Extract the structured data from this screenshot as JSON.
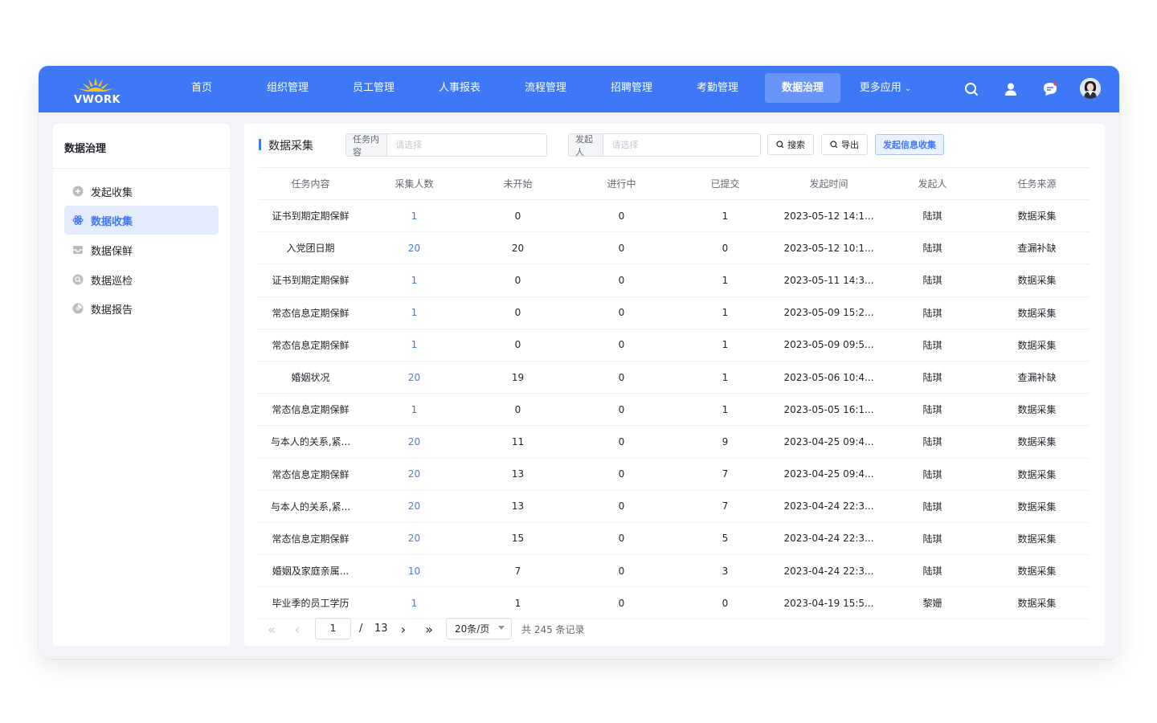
{
  "app": {
    "logo_text": "VWORK"
  },
  "nav": {
    "items": [
      "首页",
      "组织管理",
      "员工管理",
      "人事报表",
      "流程管理",
      "招聘管理",
      "考勤管理",
      "数据治理"
    ],
    "active_index": 7,
    "more_label": "更多应用"
  },
  "colors": {
    "brand": "#3f78f6",
    "active_bg": "#e3ebfd",
    "link": "#3f78f6"
  },
  "sidebar": {
    "title": "数据治理",
    "items": [
      {
        "label": "发起收集",
        "icon": "plus-circle-icon"
      },
      {
        "label": "数据收集",
        "icon": "atom-icon",
        "active": true
      },
      {
        "label": "数据保鲜",
        "icon": "inbox-icon"
      },
      {
        "label": "数据巡检",
        "icon": "inspect-icon"
      },
      {
        "label": "数据报告",
        "icon": "report-icon"
      }
    ]
  },
  "main": {
    "title": "数据采集",
    "filter_task": {
      "label": "任务内容",
      "placeholder": "请选择"
    },
    "filter_initiator": {
      "label": "发起人",
      "placeholder": "请选择"
    },
    "search_label": "搜索",
    "export_label": "导出",
    "launch_label": "发起信息收集"
  },
  "table": {
    "columns": [
      "任务内容",
      "采集人数",
      "未开始",
      "进行中",
      "已提交",
      "发起时间",
      "发起人",
      "任务来源"
    ],
    "rows": [
      [
        "证书到期定期保鲜",
        "1",
        "0",
        "0",
        "1",
        "2023-05-12 14:1...",
        "陆琪",
        "数据采集"
      ],
      [
        "入党团日期",
        "20",
        "20",
        "0",
        "0",
        "2023-05-12 10:1...",
        "陆琪",
        "查漏补缺"
      ],
      [
        "证书到期定期保鲜",
        "1",
        "0",
        "0",
        "1",
        "2023-05-11 14:3...",
        "陆琪",
        "数据采集"
      ],
      [
        "常态信息定期保鲜",
        "1",
        "0",
        "0",
        "1",
        "2023-05-09 15:2...",
        "陆琪",
        "数据采集"
      ],
      [
        "常态信息定期保鲜",
        "1",
        "0",
        "0",
        "1",
        "2023-05-09 09:5...",
        "陆琪",
        "数据采集"
      ],
      [
        "婚姻状况",
        "20",
        "19",
        "0",
        "1",
        "2023-05-06 10:4...",
        "陆琪",
        "查漏补缺"
      ],
      [
        "常态信息定期保鲜",
        "1",
        "0",
        "0",
        "1",
        "2023-05-05 16:1...",
        "陆琪",
        "数据采集"
      ],
      [
        "与本人的关系,紧...",
        "20",
        "11",
        "0",
        "9",
        "2023-04-25 09:4...",
        "陆琪",
        "数据采集"
      ],
      [
        "常态信息定期保鲜",
        "20",
        "13",
        "0",
        "7",
        "2023-04-25 09:4...",
        "陆琪",
        "数据采集"
      ],
      [
        "与本人的关系,紧...",
        "20",
        "13",
        "0",
        "7",
        "2023-04-24 22:3...",
        "陆琪",
        "数据采集"
      ],
      [
        "常态信息定期保鲜",
        "20",
        "15",
        "0",
        "5",
        "2023-04-24 22:3...",
        "陆琪",
        "数据采集"
      ],
      [
        "婚姻及家庭亲属...",
        "10",
        "7",
        "0",
        "3",
        "2023-04-24 22:3...",
        "陆琪",
        "数据采集"
      ],
      [
        "毕业季的员工学历",
        "1",
        "1",
        "0",
        "0",
        "2023-04-19 15:5...",
        "黎姗",
        "数据采集"
      ]
    ]
  },
  "pagination": {
    "current": "1",
    "separator": "/",
    "total_pages": "13",
    "page_size": "20条/页",
    "total_text": "共 245 条记录"
  }
}
